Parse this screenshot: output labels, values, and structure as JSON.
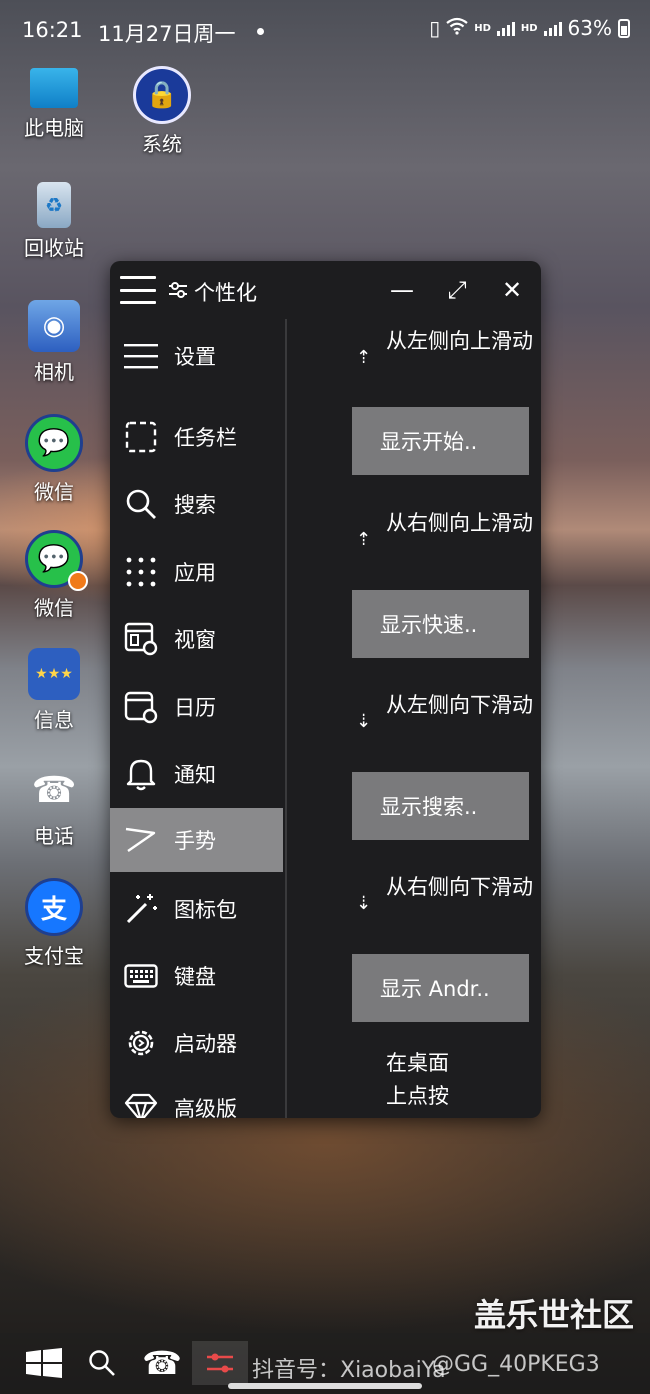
{
  "status_bar": {
    "time": "16:21",
    "date": "11月27日周一",
    "battery": "63%",
    "net1": "HD",
    "net2": "HD"
  },
  "desktop_icons": [
    {
      "label": "此电脑",
      "icon": "monitor-icon"
    },
    {
      "label": "系统",
      "icon": "system-folder-icon"
    },
    {
      "label": "回收站",
      "icon": "recycle-bin-icon"
    },
    {
      "label": "相机",
      "icon": "camera-icon"
    },
    {
      "label": "微信",
      "icon": "wechat-icon"
    },
    {
      "label": "微信",
      "icon": "wechat-clone-icon"
    },
    {
      "label": "信息",
      "icon": "messages-icon"
    },
    {
      "label": "电话",
      "icon": "phone-icon"
    },
    {
      "label": "支付宝",
      "icon": "alipay-icon"
    }
  ],
  "window": {
    "title": "个性化",
    "minimize": "—",
    "maximize": "⤢",
    "close": "✕"
  },
  "sidebar": {
    "items": [
      {
        "label": "设置",
        "icon": "menu-icon"
      },
      {
        "label": "任务栏",
        "icon": "taskbar-icon"
      },
      {
        "label": "搜索",
        "icon": "search-icon"
      },
      {
        "label": "应用",
        "icon": "apps-grid-icon"
      },
      {
        "label": "视窗",
        "icon": "window-gear-icon"
      },
      {
        "label": "日历",
        "icon": "calendar-gear-icon"
      },
      {
        "label": "通知",
        "icon": "bell-icon"
      },
      {
        "label": "手势",
        "icon": "gesture-icon",
        "selected": true
      },
      {
        "label": "图标包",
        "icon": "magic-wand-icon"
      },
      {
        "label": "键盘",
        "icon": "keyboard-icon"
      },
      {
        "label": "启动器",
        "icon": "gear-code-icon"
      },
      {
        "label": "高级版",
        "icon": "diamond-icon"
      }
    ]
  },
  "gestures": [
    {
      "label": "从左侧向上滑动",
      "action": "显示开始.."
    },
    {
      "label": "从右侧向上滑动",
      "action": "显示快速.."
    },
    {
      "label": "从左侧向下滑动",
      "action": "显示搜索.."
    },
    {
      "label": "从右侧向下滑动",
      "action": "显示 Andr.."
    },
    {
      "label": "在桌面上点按"
    }
  ],
  "watermark": "盖乐世社区",
  "taskbar": {
    "overlay_text_left": "抖音号：XiaobaiYa",
    "overlay_text_right": "@GG_40PKEG3"
  },
  "colors": {
    "window_bg": "#1d1d1f",
    "selected": "#8a8a8c",
    "action_button": "#7a7a7c"
  }
}
